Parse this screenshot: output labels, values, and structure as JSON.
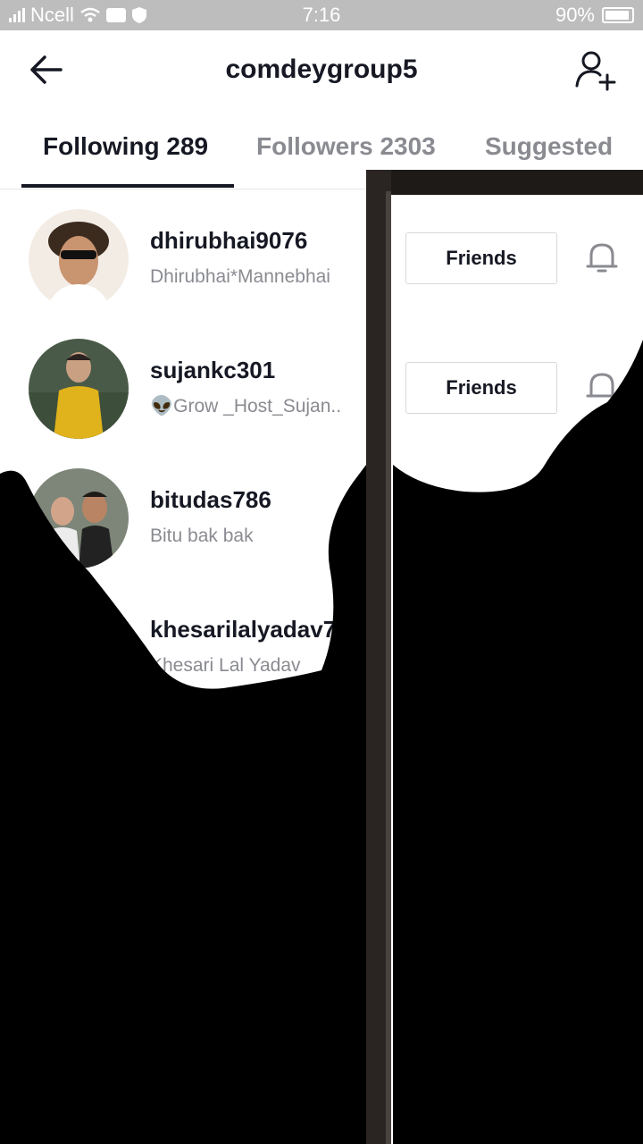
{
  "status_bar": {
    "carrier": "Ncell",
    "time": "7:16",
    "battery": "90%"
  },
  "header": {
    "title": "comdeygroup5",
    "back_icon": "arrow-left-icon",
    "add_user_icon": "person-plus-icon"
  },
  "tabs": [
    {
      "label": "Following 289",
      "active": true
    },
    {
      "label": "Followers 2303",
      "active": false
    },
    {
      "label": "Suggested",
      "active": false
    }
  ],
  "users": [
    {
      "username": "dhirubhai9076",
      "subtitle": "Dhirubhai*Mannebhai",
      "button": "Friends",
      "bell_icon": "bell-icon"
    },
    {
      "username": "sujankc301",
      "subtitle": "👽Grow _Host_Sujan..",
      "button": "Friends",
      "bell_icon": "bell-icon"
    },
    {
      "username": "bitudas786",
      "subtitle": "Bitu bak bak"
    },
    {
      "username": "khesarilalyadav7",
      "subtitle": "Khesari Lal Yadav"
    }
  ],
  "colors": {
    "text_primary": "#161823",
    "text_secondary": "#8a8b91",
    "status_bar": "#bdbdbd",
    "overlay": "#000000"
  }
}
